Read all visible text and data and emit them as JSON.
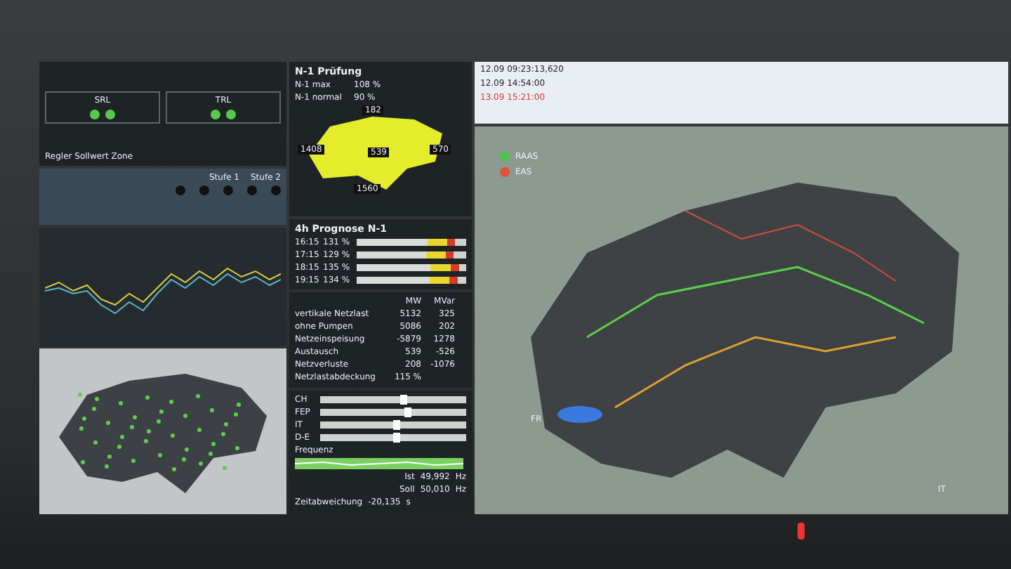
{
  "control_panel": {
    "sections": [
      "SRL",
      "TRL"
    ],
    "caption": "Regler Sollwert Zone"
  },
  "reserve": {
    "columns": [
      "Stufe 1",
      "Stufe 2"
    ]
  },
  "n1_check": {
    "title": "N-1 Prüfung",
    "rows": [
      {
        "label": "N-1 max",
        "value": "108 %"
      },
      {
        "label": "N-1 normal",
        "value": "90 %"
      }
    ],
    "flows": [
      "182",
      "1408",
      "539",
      "570",
      "1560"
    ]
  },
  "forecast": {
    "title": "4h Prognose N-1",
    "rows": [
      {
        "time": "16:15",
        "value": "131 %",
        "level": 0.9
      },
      {
        "time": "17:15",
        "value": "129 %",
        "level": 0.89
      },
      {
        "time": "18:15",
        "value": "135 %",
        "level": 0.93
      },
      {
        "time": "19:15",
        "value": "134 %",
        "level": 0.92
      }
    ]
  },
  "balance": {
    "columns": [
      "MW",
      "MVar"
    ],
    "rows": [
      {
        "label": "vertikale Netzlast",
        "mw": "5132",
        "mvar": "325"
      },
      {
        "label": "ohne Pumpen",
        "mw": "5086",
        "mvar": "202"
      },
      {
        "label": "Netzeinspeisung",
        "mw": "-5879",
        "mvar": "1278"
      },
      {
        "label": "Austausch",
        "mw": "539",
        "mvar": "-526"
      },
      {
        "label": "Netzverluste",
        "mw": "208",
        "mvar": "-1076"
      }
    ],
    "coverage": {
      "label": "Netzlastabdeckung",
      "value": "115 %"
    }
  },
  "exchange": {
    "rows": [
      {
        "label": "CH",
        "level": 0.55
      },
      {
        "label": "FEP",
        "level": 0.58
      },
      {
        "label": "IT",
        "level": 0.5
      },
      {
        "label": "D-E",
        "level": 0.5
      }
    ]
  },
  "frequency": {
    "title": "Frequenz",
    "readings": [
      {
        "label": "Ist",
        "value": "49,992",
        "unit": "Hz"
      },
      {
        "label": "Soll",
        "value": "50,010",
        "unit": "Hz"
      }
    ],
    "deviation": {
      "label": "Zeitabweichung",
      "value": "-20,135",
      "unit": "s"
    }
  },
  "events": {
    "rows": [
      {
        "time": "12.09 09:23:13,620",
        "alarm": false
      },
      {
        "time": "12.09 14:54:00",
        "alarm": false
      },
      {
        "time": "13.09 15:21:00",
        "alarm": true
      }
    ]
  },
  "legend": [
    {
      "label": "RAAS",
      "color": "#4fc34a"
    },
    {
      "label": "EAS",
      "color": "#e0523a"
    }
  ],
  "map_labels": [
    "FR",
    "IT"
  ]
}
